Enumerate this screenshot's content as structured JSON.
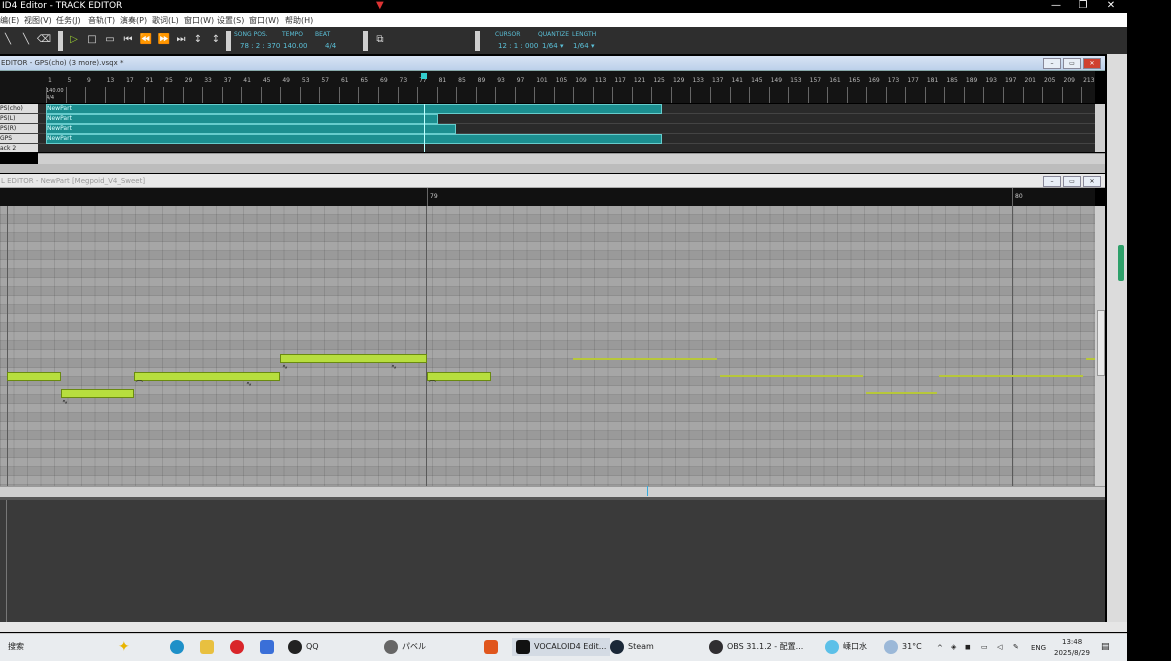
{
  "window": {
    "title": "ID4 Editor - TRACK EDITOR",
    "min": "—",
    "max": "❐",
    "close": "✕"
  },
  "menu": [
    "编(E)",
    "视图(V)",
    "任务(J)",
    "音轨(T)",
    "演奏(P)",
    "歌词(L)",
    "窗口(W)",
    "设置(S)",
    "窗口(W)",
    "帮助(H)"
  ],
  "toolbar": {
    "song_pos_label": "SONG POS.",
    "song_pos_value": "78 : 2 : 370",
    "tempo_label": "TEMPO",
    "tempo_value": "140.00",
    "beat_label": "BEAT",
    "beat_value": "4/4",
    "cursor_label": "CURSOR",
    "cursor_value": "12 : 1 : 000",
    "quantize_label": "QUANTIZE",
    "quantize_value": "1/64 ▾",
    "length_label": "LENGTH",
    "length_value": "1/64 ▾"
  },
  "track_editor": {
    "title": "EDITOR - GPS(cho) (3 more).vsqx *",
    "ruler_numbers": [
      "1",
      "5",
      "9",
      "13",
      "17",
      "21",
      "25",
      "29",
      "33",
      "37",
      "41",
      "45",
      "49",
      "53",
      "57",
      "61",
      "65",
      "69",
      "73",
      "77",
      "81",
      "85",
      "89",
      "93",
      "97",
      "101",
      "105",
      "109",
      "113",
      "117",
      "121",
      "125",
      "129",
      "133",
      "137",
      "141",
      "145",
      "149",
      "153",
      "157",
      "161",
      "165",
      "169",
      "173",
      "177",
      "181",
      "185",
      "189",
      "193",
      "197",
      "201",
      "205",
      "209",
      "213"
    ],
    "tempo_marker": "140.00",
    "beat_marker": "4/4",
    "tracks": [
      {
        "name": "PS(cho)",
        "part": "NewPart"
      },
      {
        "name": "PS(L)",
        "part": "NewPart"
      },
      {
        "name": "PS(R)",
        "part": "NewPart"
      },
      {
        "name": "GPS",
        "part": "NewPart"
      },
      {
        "name": "ack 2",
        "part": ""
      }
    ]
  },
  "piano_roll": {
    "title": "L EDITOR - NewPart [Megpoid_V4_Sweet]",
    "ruler": [
      "79",
      "80"
    ]
  },
  "taskbar": {
    "search": "搜索",
    "apps": [
      {
        "label": "QQ"
      },
      {
        "label": "パベル"
      },
      {
        "label": "VOCALOID4 Edit..."
      },
      {
        "label": "Steam"
      },
      {
        "label": "OBS 31.1.2 - 配置..."
      }
    ],
    "weather_city": "嵊口水",
    "temperature": "31°C",
    "lang": "ENG",
    "time": "13:48",
    "date": "2025/8/29"
  },
  "colors": {
    "accent_teal": "#1c8f90",
    "note_green": "#b7de3e",
    "label_cyan": "#5bc0d8"
  }
}
